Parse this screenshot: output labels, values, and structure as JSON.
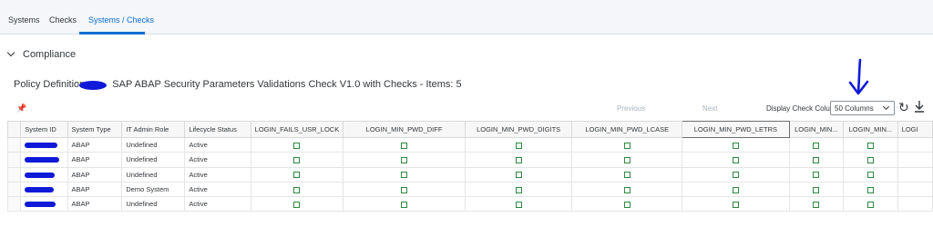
{
  "tabs": [
    {
      "label": "Systems"
    },
    {
      "label": "Checks"
    },
    {
      "label": "Systems / Checks"
    }
  ],
  "section": {
    "title": "Compliance"
  },
  "policy": {
    "prefix": "Policy Definition",
    "name": "SAP ABAP Security Parameters Validations Check V1.0 with Checks - Items: 5"
  },
  "toolbar": {
    "pin_icon": "pin-icon",
    "previous_label": "Previous",
    "next_label": "Next",
    "display_label": "Display Check Columns",
    "columns_value": "50 Columns",
    "refresh_icon": "refresh-icon",
    "download_icon": "download-icon"
  },
  "colors": {
    "accent": "#0a6ed1",
    "checkbox": "#2b8a3e",
    "redaction": "#0f1ad8"
  },
  "table": {
    "headers": [
      "System ID",
      "System Type",
      "IT Admin Role",
      "Lifecycle Status"
    ],
    "check_headers": [
      "LOGIN_FAILS_USR_LOCK",
      "LOGIN_MIN_PWD_DIFF",
      "LOGIN_MIN_PWD_DIGITS",
      "LOGIN_MIN_PWD_LCASE",
      "LOGIN_MIN_PWD_LETRS",
      "LOGIN_MIN...",
      "LOGIN_MIN...",
      "LOGI"
    ],
    "rows": [
      {
        "system_type": "ABAP",
        "admin_role": "Undefined",
        "lifecycle": "Active"
      },
      {
        "system_type": "ABAP",
        "admin_role": "Undefined",
        "lifecycle": "Active"
      },
      {
        "system_type": "ABAP",
        "admin_role": "Undefined",
        "lifecycle": "Active"
      },
      {
        "system_type": "ABAP",
        "admin_role": "Demo System",
        "lifecycle": "Active"
      },
      {
        "system_type": "ABAP",
        "admin_role": "Undefined",
        "lifecycle": "Active"
      }
    ]
  }
}
